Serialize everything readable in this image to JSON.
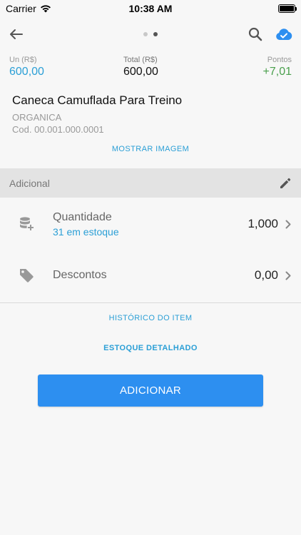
{
  "status_bar": {
    "carrier": "Carrier",
    "time": "10:38 AM"
  },
  "nav": {
    "page_count": 2,
    "active_page": 2
  },
  "totals": {
    "unit_label": "Un (R$)",
    "unit_value": "600,00",
    "total_label": "Total (R$)",
    "total_value": "600,00",
    "points_label": "Pontos",
    "points_value": "+7,01"
  },
  "product": {
    "name": "Caneca Camuflada Para Treino",
    "brand": "ORGANICA",
    "code": "Cod. 00.001.000.0001",
    "show_image_label": "MOSTRAR IMAGEM"
  },
  "section": {
    "title": "Adicional"
  },
  "quantity": {
    "label": "Quantidade",
    "stock": "31 em estoque",
    "value": "1,000"
  },
  "discounts": {
    "label": "Descontos",
    "value": "0,00"
  },
  "links": {
    "history": "HISTÓRICO DO ITEM",
    "stock_detail": "ESTOQUE DETALHADO"
  },
  "actions": {
    "add_label": "ADICIONAR"
  },
  "colors": {
    "accent": "#2b9fd6",
    "button": "#2d8ff0",
    "points": "#4aa04d"
  }
}
